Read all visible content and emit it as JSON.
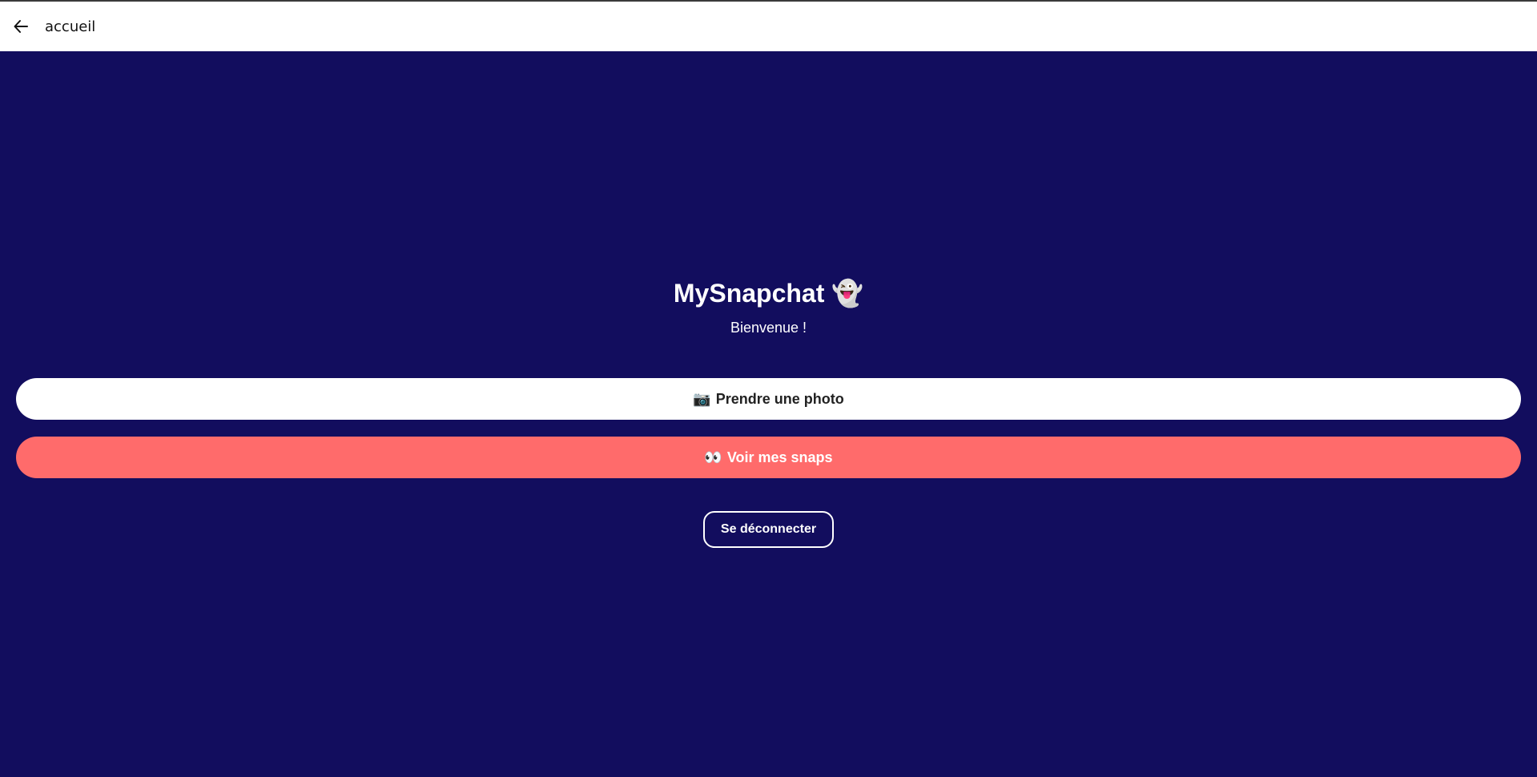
{
  "header": {
    "title": "accueil",
    "back_icon": "arrow-left-icon"
  },
  "main": {
    "title": "MySnapchat",
    "title_emoji": "👻",
    "subtitle": "Bienvenue !",
    "take_photo_emoji": "📷",
    "take_photo_label": "Prendre une photo",
    "view_snaps_emoji": "👀",
    "view_snaps_label": "Voir mes snaps",
    "logout_label": "Se déconnecter"
  },
  "colors": {
    "background": "#120d5e",
    "primary_button": "#ffffff",
    "accent_button": "#ff6b6b"
  }
}
